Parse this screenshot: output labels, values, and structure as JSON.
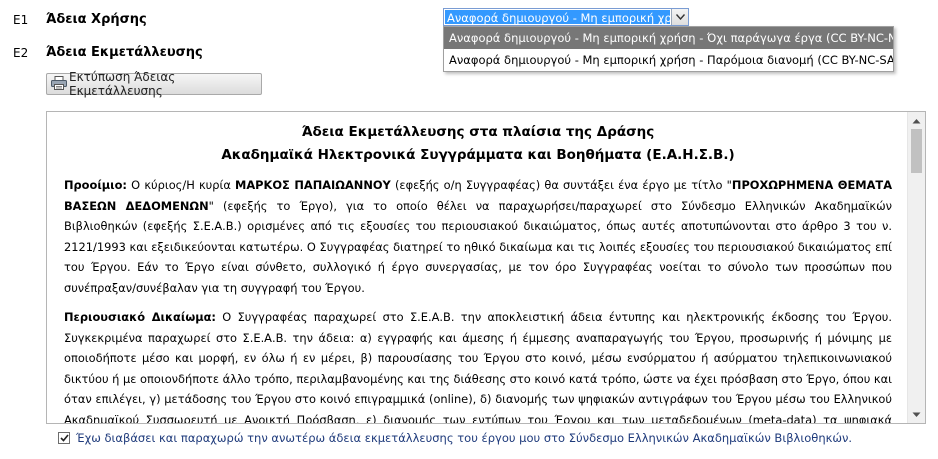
{
  "rows": [
    {
      "code": "E1",
      "title": "Άδεια Χρήσης"
    },
    {
      "code": "E2",
      "title": "Άδεια Εκμετάλλευσης"
    }
  ],
  "license_select": {
    "value": "Αναφορά δημιουργού - Μη εμπορική χρή",
    "options": [
      "Αναφορά δημιουργού - Μη εμπορική χρήση - Όχι παράγωγα έργα (CC BY-NC-ND)",
      "Αναφορά δημιουργού - Μη εμπορική χρήση - Παρόμοια διανομή (CC BY-NC-SA)"
    ],
    "highlighted_index": 0
  },
  "print_button": {
    "label": "Εκτύπωση Άδειας Εκμετάλλευσης",
    "icon": "printer-icon"
  },
  "document": {
    "title_line1": "Άδεια Εκμετάλλευσης στα πλαίσια της Δράσης",
    "title_line2": "Ακαδημαϊκά Ηλεκτρονικά Συγγράμματα και Βοηθήματα (Ε.Α.Η.Σ.Β.)",
    "prooimio": {
      "label": "Προοίμιο:",
      "t1": " Ο κύριος/Η κυρία ",
      "author": "ΜΑΡΚΟΣ ΠΑΠΑΙΩΑΝΝΟΥ",
      "t2": " (εφεξής ο/η Συγγραφέας) θα συντάξει ένα έργο με τίτλο \"",
      "work_title": "ΠΡΟΧΩΡΗΜΕΝΑ ΘΕΜΑΤΑ ΒΑΣΕΩΝ ΔΕΔΟΜΕΝΩΝ",
      "t3": "\" (εφεξής το Έργο), για το οποίο θέλει να παραχωρήσει/παραχωρεί στο Σύνδεσμο Ελληνικών Ακαδημαϊκών Βιβλιοθηκών (εφεξής Σ.Ε.Α.Β.) ορισμένες από τις εξουσίες του περιουσιακού δικαιώματος, όπως αυτές αποτυπώνονται στο άρθρο 3 του ν. 2121/1993 και εξειδικεύονται κατωτέρω. Ο Συγγραφέας διατηρεί το ηθικό δικαίωμα και τις λοιπές εξουσίες του περιουσιακού δικαιώματος επί του Έργου. Εάν το Έργο είναι σύνθετο, συλλογικό ή έργο συνεργασίας, με τον όρο Συγγραφέας νοείται το σύνολο των προσώπων που συνέπραξαν/συνέβαλαν για τη συγγραφή του Έργου."
    },
    "periousiako": {
      "label": "Περιουσιακό Δικαίωμα:",
      "text": " Ο Συγγραφέας παραχωρεί στο Σ.Ε.Α.Β. την αποκλειστική άδεια έντυπης και ηλεκτρονικής έκδοσης του Έργου. Συγκεκριμένα παραχωρεί στο Σ.Ε.Α.Β. την άδεια: α) εγγραφής και άμεσης ή έμμεσης αναπαραγωγής του Έργου, προσωρινής ή μόνιμης με οποιοδήποτε μέσο και μορφή, εν όλω ή εν μέρει, β) παρουσίασης του Έργου στο κοινό, μέσω ενσύρματου ή ασύρματου τηλεπικοινωνιακού δικτύου ή με οποιονδήποτε άλλο τρόπο, περιλαμβανομένης και της διάθεσης στο κοινό κατά τρόπο, ώστε να έχει πρόσβαση στο Έργο, όπου και όταν επιλέγει, γ) μετάδοσης του Έργου στο κοινό επιγραμμικά (online), δ) διανομής των ψηφιακών αντιγράφων του Έργου μέσω του Ελληνικού Ακαδημαϊκού Συσσωρευτή με Ανοικτή Πρόσβαση, ε) διανομής των εντύπων του Έργου και των μεταδεδομένων (meta-data) τα ψηφιακά αντίγραφα του Έργου"
    }
  },
  "agreement": {
    "checked": true,
    "text": "Έχω διαβάσει και παραχωρώ την ανωτέρω άδεια εκμετάλλευσης του έργου μου στο Σύνδεσμο Ελληνικών Ακαδημαϊκών Βιβλιοθηκών."
  }
}
